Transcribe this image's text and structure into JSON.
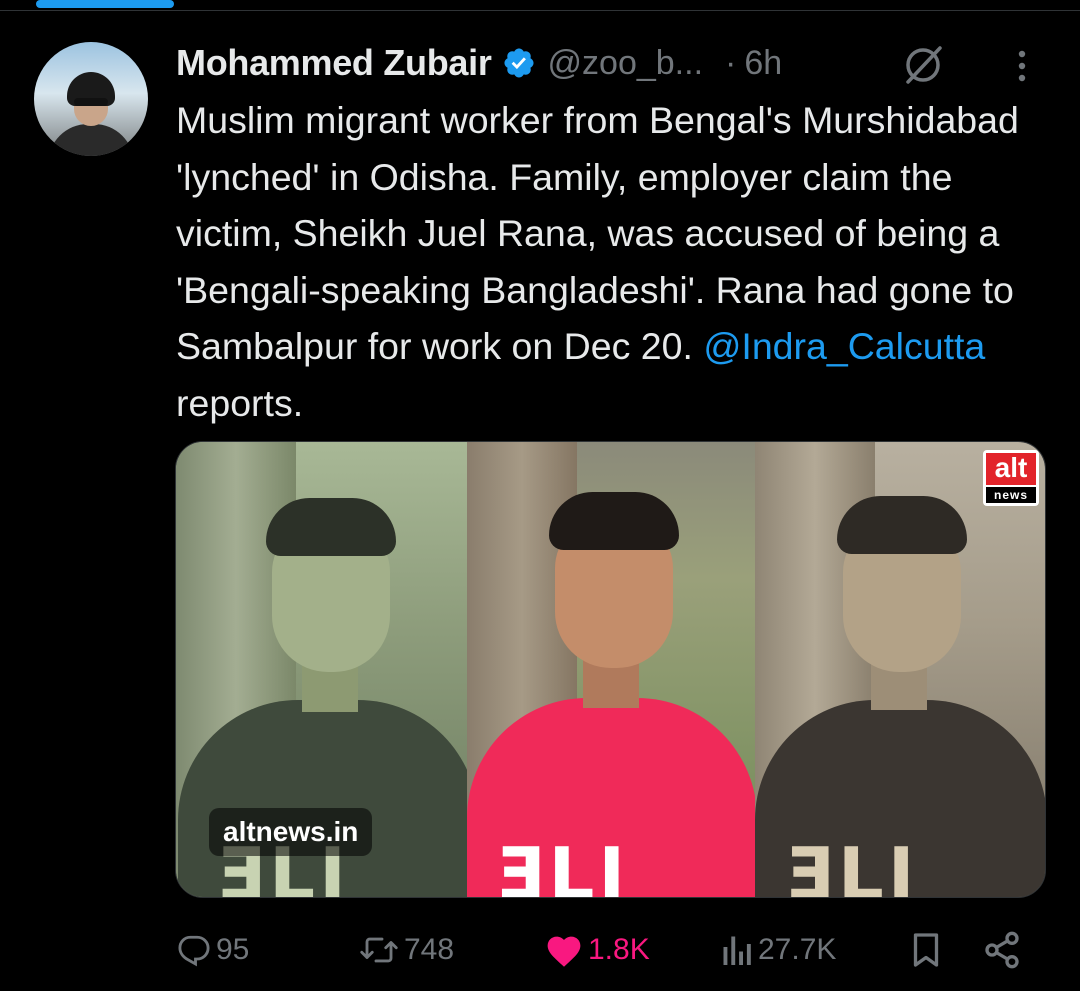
{
  "author": {
    "name": "Mohammed Zubair",
    "handle": "@zoo_b...",
    "separator": "·",
    "time": "6h",
    "avatar_icon": "profile-photo"
  },
  "tweet": {
    "text_before_mention": "Muslim migrant worker from Bengal's Murshidabad 'lynched' in Odisha. Family, employer claim the victim, Sheikh Juel Rana, was accused of being a 'Bengali-speaking Bangladeshi'. Rana had gone to Sambalpur for work on Dec 20. ",
    "mention": "@Indra_Calcutta",
    "text_after_mention": " reports."
  },
  "media": {
    "watermark": "altnews.in",
    "logo_top": "alt",
    "logo_bottom": "news"
  },
  "actions": {
    "replies": "95",
    "reposts": "748",
    "likes": "1.8K",
    "views": "27.7K"
  },
  "colors": {
    "accent": "#1d9bf0",
    "like": "#f91880",
    "muted": "#71767b",
    "text": "#e7e9ea",
    "background": "#000000"
  },
  "icons": [
    "verified-badge-icon",
    "grok-icon",
    "more-icon",
    "reply-icon",
    "repost-icon",
    "like-icon",
    "views-icon",
    "bookmark-icon",
    "share-icon"
  ]
}
